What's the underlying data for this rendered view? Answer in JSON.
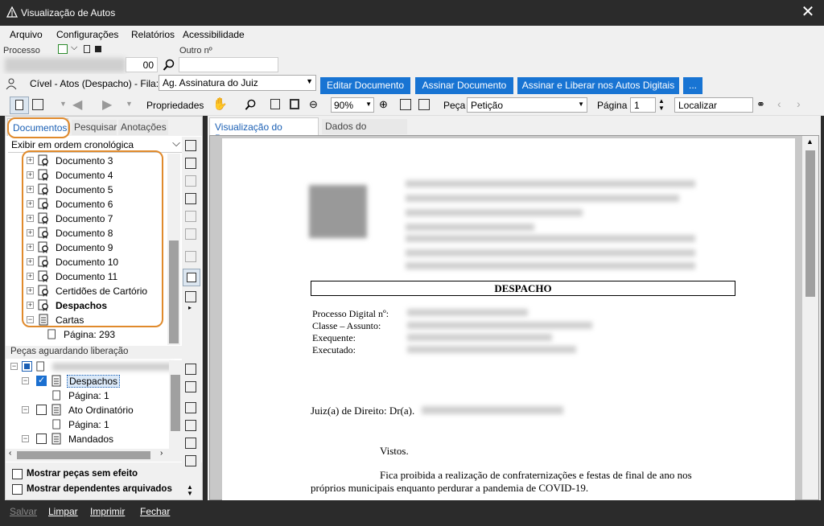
{
  "window": {
    "title": "Visualização de Autos",
    "close": "✕"
  },
  "menu": [
    "Arquivo",
    "Configurações",
    "Relatórios",
    "Acessibilidade"
  ],
  "fields": {
    "processo_label": "Processo",
    "processo_suffix": "00",
    "outro_label": "Outro nº"
  },
  "queue": {
    "text": "Cível - Atos (Despacho) - Fila:",
    "value": "Ag. Assinatura do Juiz"
  },
  "buttons": {
    "editar": "Editar Documento",
    "assinar": "Assinar Documento",
    "assinar_liberar": "Assinar e Liberar nos Autos Digitais",
    "more": "..."
  },
  "toolbar": {
    "propriedades": "Propriedades",
    "zoom": "90%",
    "peca_label": "Peça",
    "peca_value": "Petição",
    "pagina_label": "Página",
    "pagina_value": "1",
    "localizar": "Localizar"
  },
  "left_tabs": [
    "Documentos",
    "Pesquisar",
    "Anotações"
  ],
  "order_select": "Exibir em ordem cronológica",
  "documents": [
    "Documento 3",
    "Documento 4",
    "Documento 5",
    "Documento 6",
    "Documento 7",
    "Documento 8",
    "Documento 9",
    "Documento 10",
    "Documento 11",
    "Certidões de Cartório",
    "Despachos",
    "Cartas"
  ],
  "cartas_child": "Página: 293",
  "pending": {
    "header": "Peças aguardando liberação",
    "items": [
      {
        "label": "Despachos",
        "page": "Página: 1",
        "checked": true
      },
      {
        "label": "Ato Ordinatório",
        "page": "Página: 1",
        "checked": false
      },
      {
        "label": "Mandados",
        "checked": false
      }
    ]
  },
  "options": {
    "show_no_effect": "Mostrar peças sem efeito",
    "show_archived": "Mostrar dependentes arquivados"
  },
  "right_tabs": [
    "Visualização do Processo",
    "Dados do processo"
  ],
  "document": {
    "heading": "DESPACHO",
    "fields": [
      "Processo Digital nº:",
      "Classe – Assunto:",
      "Exequente:",
      "Executado:"
    ],
    "judge": "Juiz(a) de Direito: Dr(a).",
    "vistos": "Vistos.",
    "para1": "Fica proibida a realização de confraternizações e festas de final de ano nos",
    "para2": "próprios municipais enquanto perdurar a pandemia de COVID-19."
  },
  "status": [
    "Salvar",
    "Limpar",
    "Imprimir",
    "Fechar"
  ]
}
